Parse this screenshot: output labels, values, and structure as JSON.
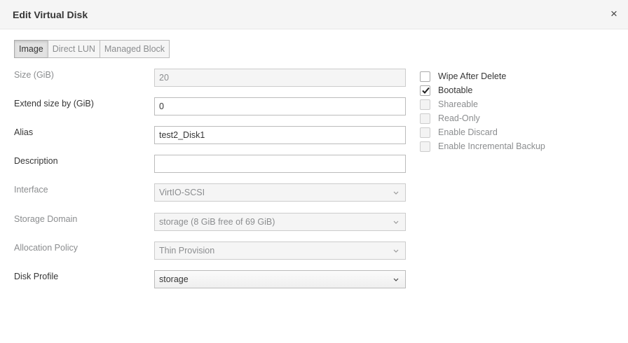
{
  "dialog": {
    "title": "Edit Virtual Disk",
    "close_symbol": "×"
  },
  "tabs": [
    {
      "label": "Image",
      "active": true
    },
    {
      "label": "Direct LUN",
      "active": false
    },
    {
      "label": "Managed Block",
      "active": false
    }
  ],
  "form": {
    "size": {
      "label": "Size (GiB)",
      "value": "20"
    },
    "extend": {
      "label": "Extend size by (GiB)",
      "value": "0"
    },
    "alias": {
      "label": "Alias",
      "value": "test2_Disk1"
    },
    "description": {
      "label": "Description",
      "value": ""
    },
    "interface": {
      "label": "Interface",
      "value": "VirtIO-SCSI"
    },
    "storage_domain": {
      "label": "Storage Domain",
      "value": "storage (8 GiB free of 69 GiB)"
    },
    "allocation_policy": {
      "label": "Allocation Policy",
      "value": "Thin Provision"
    },
    "disk_profile": {
      "label": "Disk Profile",
      "value": "storage"
    }
  },
  "checkboxes": [
    {
      "label": "Wipe After Delete",
      "checked": false,
      "enabled": true
    },
    {
      "label": "Bootable",
      "checked": true,
      "enabled": true
    },
    {
      "label": "Shareable",
      "checked": false,
      "enabled": false
    },
    {
      "label": "Read-Only",
      "checked": false,
      "enabled": false
    },
    {
      "label": "Enable Discard",
      "checked": false,
      "enabled": false
    },
    {
      "label": "Enable Incremental Backup",
      "checked": false,
      "enabled": false
    }
  ],
  "icons": {
    "close": "close-icon",
    "dropdown": "chevron-down-icon",
    "check": "checkmark-icon"
  }
}
